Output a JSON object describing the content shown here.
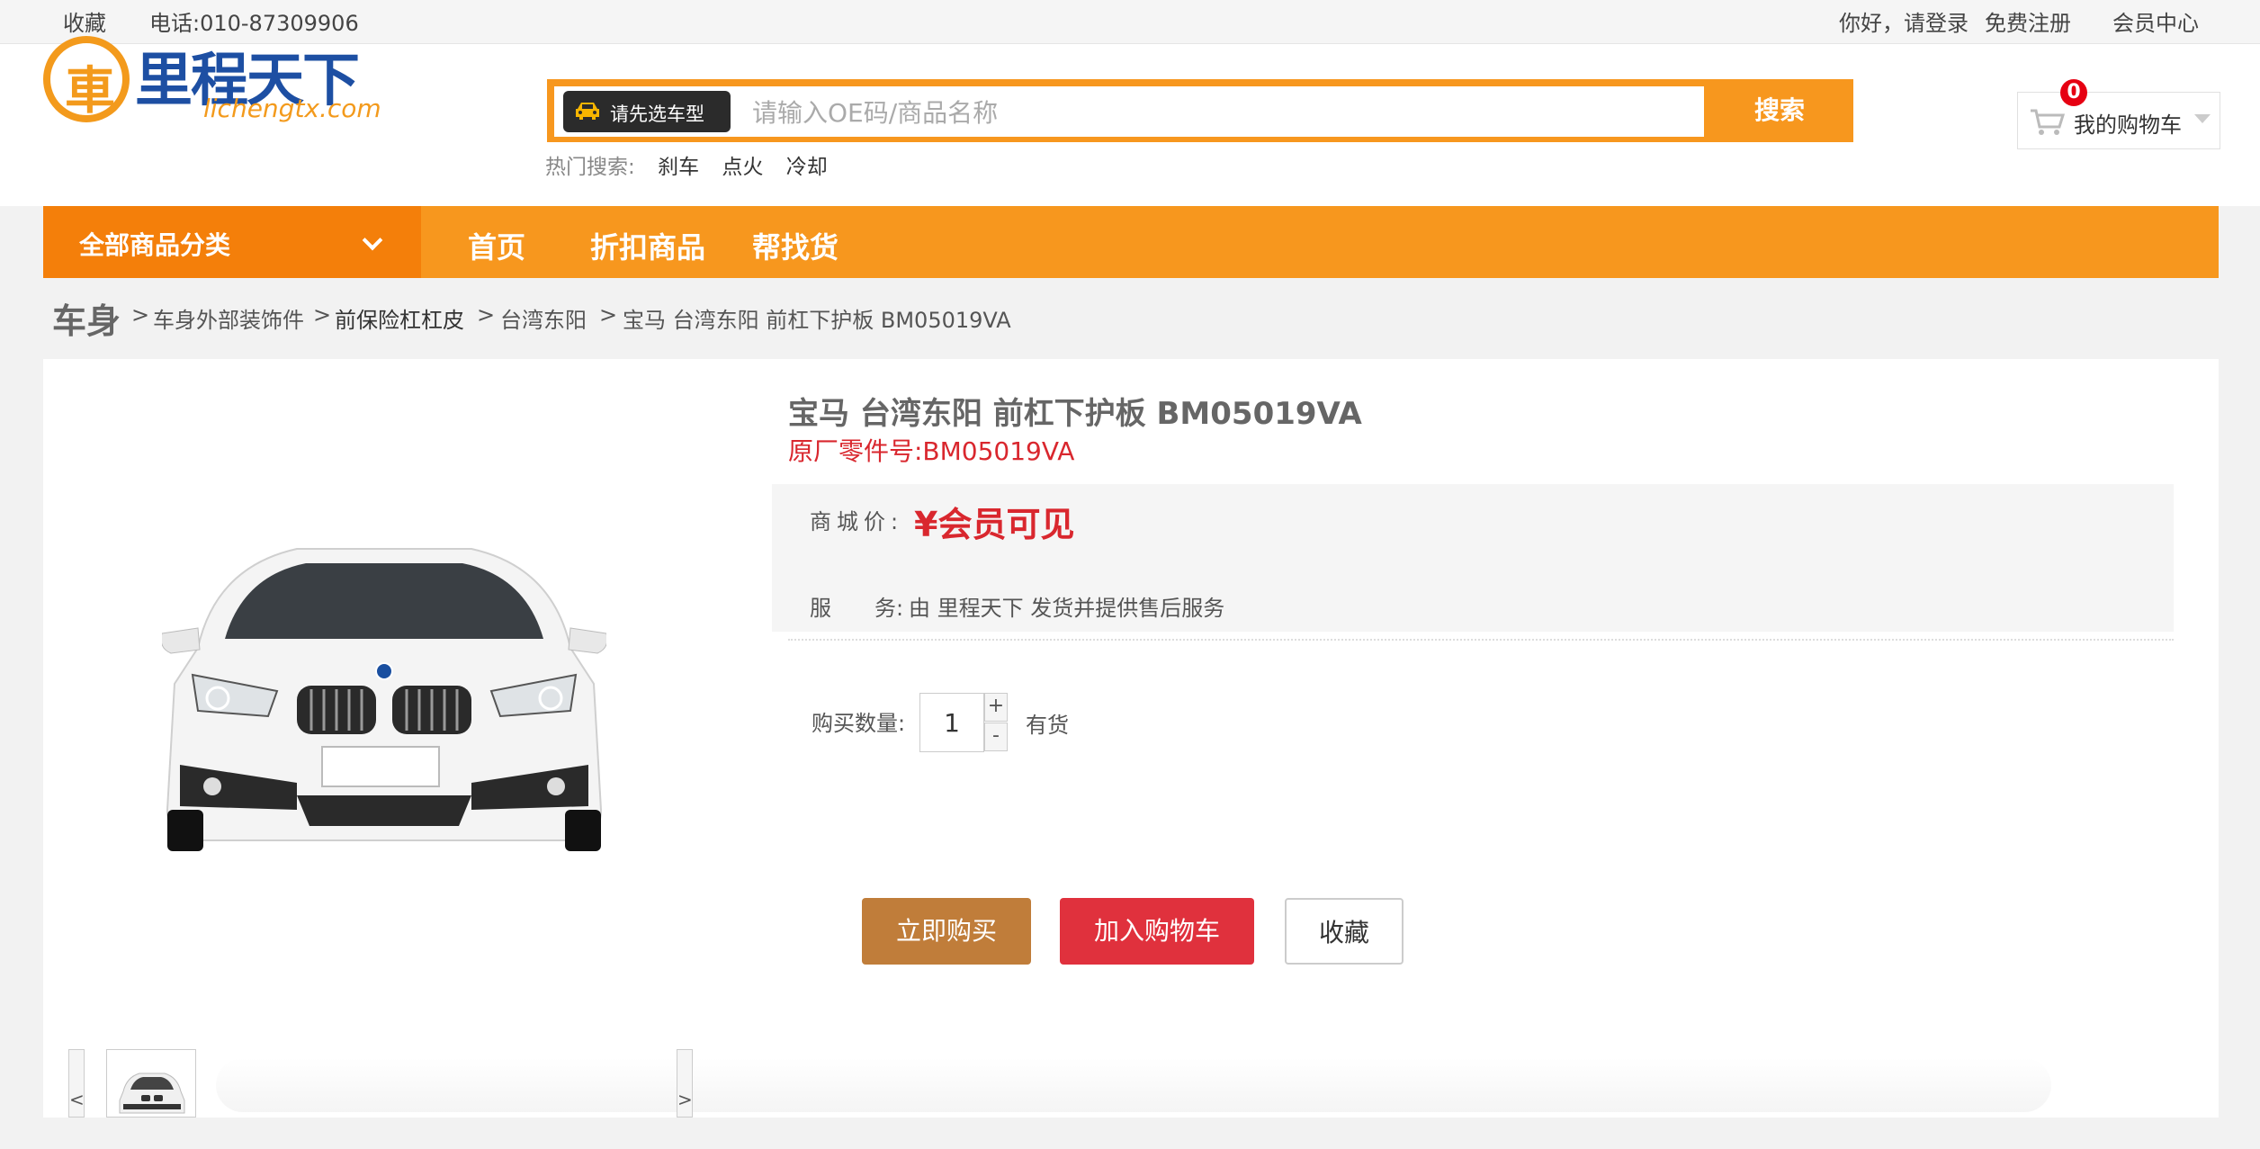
{
  "topbar": {
    "favorite": "收藏",
    "phone": "电话:010-87309906",
    "greeting_login": "你好，请登录",
    "register": "免费注册",
    "member_center": "会员中心"
  },
  "header": {
    "logo_text": "里程天下",
    "logo_mark": "車",
    "logo_domain": "lichengtx.com",
    "search": {
      "car_select_label": "请先选车型",
      "placeholder": "请输入OE码/商品名称",
      "button_label": "搜索"
    },
    "hot_search": {
      "label": "热门搜索:",
      "keywords": [
        "刹车",
        "点火",
        "冷却"
      ]
    },
    "cart": {
      "label": "我的购物车",
      "count": "0"
    }
  },
  "nav": {
    "all_categories": "全部商品分类",
    "links": [
      "首页",
      "折扣商品",
      "帮找货"
    ]
  },
  "breadcrumb": {
    "root": "车身",
    "items": [
      "车身外部装饰件",
      "前保险杠杠皮",
      "台湾东阳",
      "宝马 台湾东阳 前杠下护板 BM05019VA"
    ],
    "separator": ">"
  },
  "product": {
    "title": "宝马 台湾东阳 前杠下护板 BM05019VA",
    "oe_number": "原厂零件号:BM05019VA",
    "price_label": "商城价:",
    "price": "¥会员可见",
    "service_label_a": "服",
    "service_label_b": "务:",
    "service": "由 里程天下 发货并提供售后服务",
    "quantity_label": "购买数量:",
    "quantity": "1",
    "plus": "+",
    "minus": "-",
    "stock": "有货",
    "buttons": {
      "buy_now": "立即购买",
      "add_to_cart": "加入购物车",
      "favorite": "收藏"
    }
  },
  "thumbs": {
    "prev": "<",
    "next": ">"
  },
  "colors": {
    "brand_orange": "#f7971e",
    "price_red": "#d9272e",
    "buy_brown": "#c07d3a",
    "cart_red": "#e0313d"
  }
}
